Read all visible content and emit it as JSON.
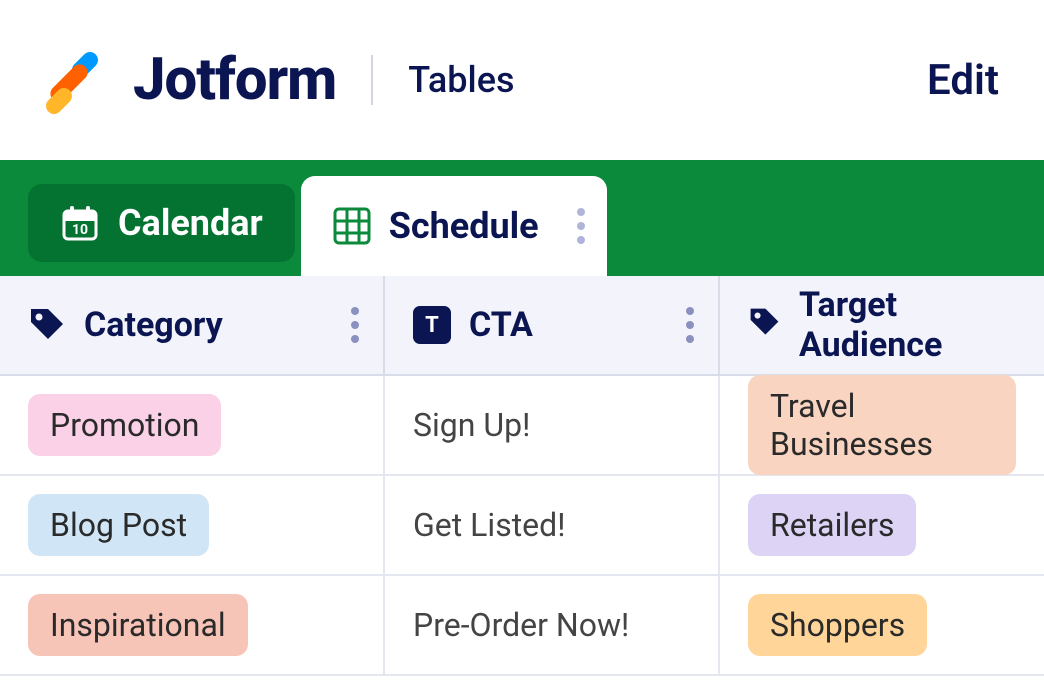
{
  "header": {
    "brand": "Jotform",
    "product": "Tables",
    "edit": "Edit"
  },
  "tabs": {
    "calendar": "Calendar",
    "schedule": "Schedule"
  },
  "columns": {
    "category": "Category",
    "cta": "CTA",
    "target": "Target Audience"
  },
  "rows": [
    {
      "category": "Promotion",
      "cta": "Sign Up!",
      "target": "Travel Businesses"
    },
    {
      "category": "Blog Post",
      "cta": "Get Listed!",
      "target": "Retailers"
    },
    {
      "category": "Inspirational",
      "cta": "Pre-Order Now!",
      "target": "Shoppers"
    }
  ],
  "pillColors": {
    "category": [
      "pink",
      "lightblue",
      "salmon"
    ],
    "target": [
      "peach",
      "lilac",
      "orange"
    ]
  }
}
